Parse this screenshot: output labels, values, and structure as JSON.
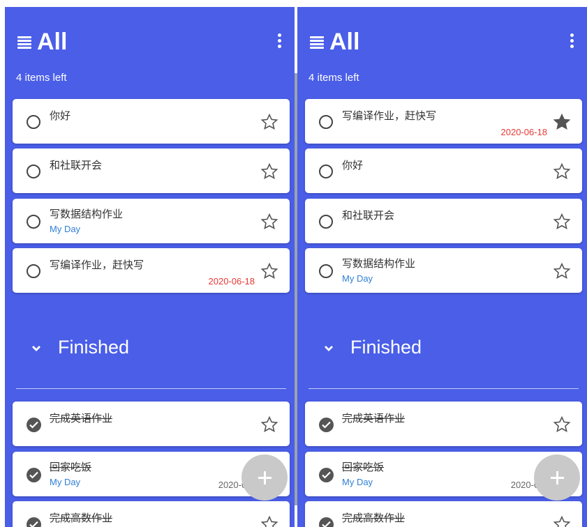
{
  "left": {
    "title": "All",
    "items_left": "4 items left",
    "tasks": [
      {
        "text": "你好",
        "tag": "",
        "date": "",
        "starred": false
      },
      {
        "text": "和社联开会",
        "tag": "",
        "date": "",
        "starred": false
      },
      {
        "text": "写数据结构作业",
        "tag": "My Day",
        "date": "",
        "starred": false
      },
      {
        "text": "写编译作业，赶快写",
        "tag": "",
        "date": "2020-06-18",
        "starred": false
      }
    ],
    "finished_label": "Finished",
    "finished": [
      {
        "text": "完成英语作业",
        "tag": "",
        "date": ""
      },
      {
        "text": "回家吃饭",
        "tag": "My Day",
        "date": "2020-06-2"
      },
      {
        "text": "完成高数作业",
        "tag": "",
        "date": ""
      }
    ]
  },
  "right": {
    "title": "All",
    "items_left": "4 items left",
    "tasks": [
      {
        "text": "写编译作业，赶快写",
        "tag": "",
        "date": "2020-06-18",
        "starred": true
      },
      {
        "text": "你好",
        "tag": "",
        "date": "",
        "starred": false
      },
      {
        "text": "和社联开会",
        "tag": "",
        "date": "",
        "starred": false
      },
      {
        "text": "写数据结构作业",
        "tag": "My Day",
        "date": "",
        "starred": false
      }
    ],
    "finished_label": "Finished",
    "finished": [
      {
        "text": "完成英语作业",
        "tag": "",
        "date": ""
      },
      {
        "text": "回家吃饭",
        "tag": "My Day",
        "date": "2020-06-2"
      },
      {
        "text": "完成高数作业",
        "tag": "",
        "date": ""
      }
    ]
  },
  "colors": {
    "header_bg": "#4a5ee8",
    "date_red": "#e53935",
    "tag_blue": "#2f7fd6"
  }
}
